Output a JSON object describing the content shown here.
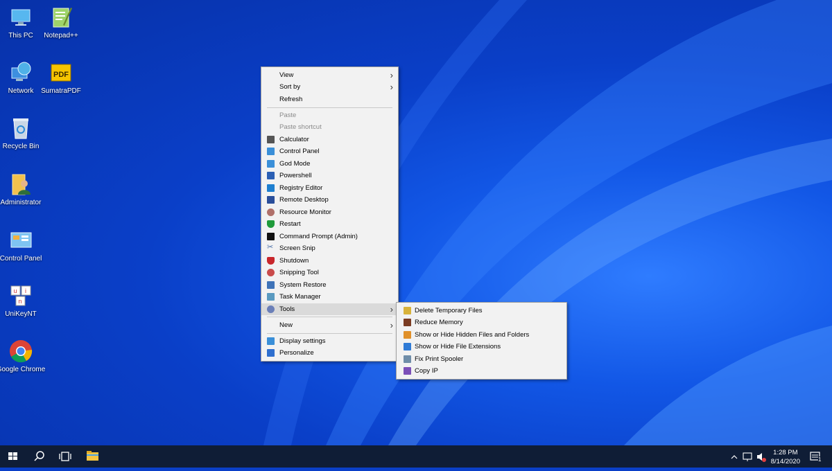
{
  "desktop_icons": [
    {
      "label": "This PC",
      "icon": "this-pc-icon"
    },
    {
      "label": "Notepad++",
      "icon": "notepadpp-icon"
    },
    {
      "label": "Network",
      "icon": "network-icon"
    },
    {
      "label": "SumatraPDF",
      "icon": "sumatrapdf-icon"
    },
    {
      "label": "Recycle Bin",
      "icon": "recycle-bin-icon"
    },
    {
      "label": "Administrator",
      "icon": "user-folder-icon"
    },
    {
      "label": "Control Panel",
      "icon": "control-panel-icon"
    },
    {
      "label": "UniKeyNT",
      "icon": "unikey-icon"
    },
    {
      "label": "Google Chrome",
      "icon": "chrome-icon"
    }
  ],
  "context_menu": {
    "view": "View",
    "sort_by": "Sort by",
    "refresh": "Refresh",
    "paste": "Paste",
    "paste_shortcut": "Paste shortcut",
    "items": [
      {
        "label": "Calculator",
        "icon": "calculator-icon",
        "color": "#555555"
      },
      {
        "label": "Control Panel",
        "icon": "control-panel-icon",
        "color": "#3a8fd8"
      },
      {
        "label": "God Mode",
        "icon": "god-mode-icon",
        "color": "#3a8fd8"
      },
      {
        "label": "Powershell",
        "icon": "powershell-icon",
        "color": "#2b5fb4"
      },
      {
        "label": "Registry Editor",
        "icon": "registry-icon",
        "color": "#1e7fd0"
      },
      {
        "label": "Remote Desktop",
        "icon": "remote-desktop-icon",
        "color": "#2a4e9a"
      },
      {
        "label": "Resource Monitor",
        "icon": "resource-monitor-icon",
        "color": "#b0706a"
      },
      {
        "label": "Restart",
        "icon": "shield-check-icon",
        "color": "#1f9a3a"
      },
      {
        "label": "Command Prompt (Admin)",
        "icon": "cmd-icon",
        "color": "#111111"
      },
      {
        "label": "Screen Snip",
        "icon": "scissors-icon",
        "color": "#4a6fa8"
      },
      {
        "label": "Shutdown",
        "icon": "shield-x-icon",
        "color": "#c8262b"
      },
      {
        "label": "Snipping Tool",
        "icon": "snipping-tool-icon",
        "color": "#c94b4b"
      },
      {
        "label": "System Restore",
        "icon": "system-restore-icon",
        "color": "#3f73b8"
      },
      {
        "label": "Task Manager",
        "icon": "task-manager-icon",
        "color": "#5a9ac0"
      },
      {
        "label": "Tools",
        "icon": "tools-icon",
        "color": "#6b7fb8"
      }
    ],
    "new": "New",
    "display_settings": "Display settings",
    "personalize": "Personalize"
  },
  "tools_submenu": [
    {
      "label": "Delete Temporary Files",
      "icon": "broom-icon",
      "color": "#d8b23a"
    },
    {
      "label": "Reduce Memory",
      "icon": "memory-icon",
      "color": "#7a3b22"
    },
    {
      "label": "Show or Hide Hidden Files and Folders",
      "icon": "hidden-files-icon",
      "color": "#e0902a"
    },
    {
      "label": "Show or Hide File Extensions",
      "icon": "file-extensions-icon",
      "color": "#2f7bd6"
    },
    {
      "label": "Fix Print Spooler",
      "icon": "printer-icon",
      "color": "#6f8da8"
    },
    {
      "label": "Copy IP",
      "icon": "copy-ip-icon",
      "color": "#7b4fb8"
    }
  ],
  "taskbar": {
    "time": "1:28 PM",
    "date": "8/14/2020",
    "notification_count": "1"
  },
  "colors": {
    "desktop": "#0a3fc8",
    "taskbar": "#0f1d36",
    "menu_bg": "#f2f2f2",
    "menu_highlight": "#dadada"
  }
}
